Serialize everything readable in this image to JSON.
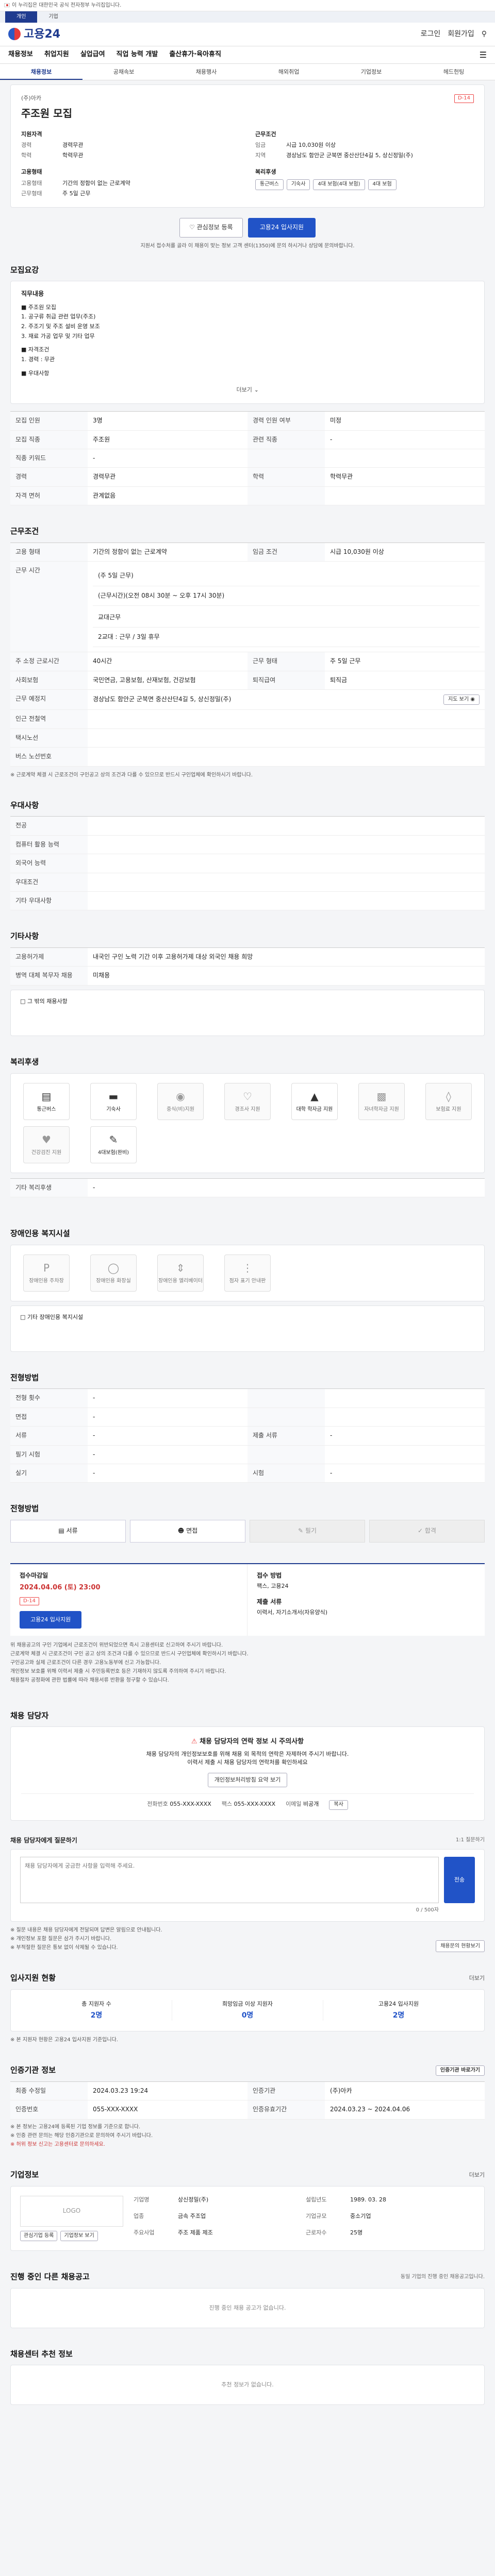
{
  "gov_bar": {
    "text": "이 누리집은 대한민국 공식 전자정부 누리집입니다."
  },
  "top_tabs": [
    {
      "label": "개인"
    },
    {
      "label": "기업"
    }
  ],
  "header": {
    "logo": "고용24",
    "right": [
      "로그인",
      "회원가입",
      "전체검색"
    ]
  },
  "gnb": [
    "채용정보",
    "취업지원",
    "실업급여",
    "직업 능력 개발",
    "출산휴가·육아휴직"
  ],
  "subnav": [
    {
      "label": "채용정보"
    },
    {
      "label": "공채속보"
    },
    {
      "label": "채용행사"
    },
    {
      "label": "해외취업"
    },
    {
      "label": "기업정보"
    },
    {
      "label": "헤드헌팅"
    }
  ],
  "job": {
    "company": "(주)아카",
    "title": "주조원 모집",
    "badge": "D-14",
    "left_h": "지원자격",
    "left": [
      [
        "경력",
        "경력무관"
      ],
      [
        "학력",
        "학력무관"
      ]
    ],
    "left_h2": "고용형태",
    "left2": [
      [
        "고용형태",
        "기간의 정함이 없는 근로계약"
      ],
      [
        "근무형태",
        "주 5일 근무"
      ]
    ],
    "right_h": "근무조건",
    "right": [
      [
        "임금",
        "시급 10,030원 이상"
      ],
      [
        "지역",
        "경상남도 함안군 군북면 중산산단4길 5, 상신정밀(주)"
      ]
    ],
    "right_h2": "복리후생",
    "chips": [
      "통근버스",
      "기숙사",
      "4대 보험(4대 보험)",
      "4대 보험"
    ],
    "btn_like": "관심정보 등록",
    "btn_apply": "고용24 입사지원",
    "notice": "지원서 접수처를 골라 이 채용이 맞는 정보 고객 센터(1350)에 문의 하시거나 상담에 문의바랍니다."
  },
  "recruit": {
    "title": "모집요강",
    "desc_label": "직무내용",
    "desc": [
      "■ 주조원 모집",
      "1. 공구류 취급 관련 업무(주조)",
      "2. 주조기 및 주조 설비 운영 보조",
      "3. 재료 가공 업무 및 기타 업무",
      "■ 자격조건",
      "1. 경력 : 무관",
      "■ 우대사항"
    ],
    "more": "더보기",
    "rows": [
      [
        "모집 인원",
        "3명",
        "경력 인원 여부",
        "미정"
      ],
      [
        "모집 직종",
        "주조원",
        "관련 직종",
        "-"
      ],
      [
        "직종 키워드",
        "-",
        "",
        ""
      ],
      [
        "경력",
        "경력무관",
        "학력",
        "학력무관"
      ],
      [
        "자격 면허",
        "관계없음",
        "",
        ""
      ]
    ]
  },
  "conditions": {
    "title": "근무조건",
    "rows": [
      [
        "고용 형태",
        "기간의 정함이 없는 근로계약",
        "임금 조건",
        "시급 10,030원 이상"
      ]
    ],
    "hours_k": "근무 시간",
    "hours": [
      "(주 5일 근무)",
      "(근무시간)(오전 08시 30분 ~ 오후 17시 30분)",
      "교대근무",
      "2교대 : 근무 / 3일 휴무"
    ],
    "rows2": [
      [
        "주 소정 근로시간",
        "40시간",
        "근무 형태",
        "주 5일 근무"
      ],
      [
        "사회보험",
        "국민연금, 고용보험, 산재보험, 건강보험",
        "퇴직급여",
        "퇴직금"
      ]
    ],
    "addr_k": "근무 예정지",
    "addr": "경상남도 함안군 군북면 중산산단4길 5, 상신정밀(주)",
    "map_btn": "지도 보기",
    "rows3": [
      [
        "인근 전철역",
        ""
      ],
      [
        "택시노선",
        ""
      ],
      [
        "버스 노선번호",
        ""
      ]
    ],
    "footnote": "※ 근로계약 체결 시 근로조건이 구인공고 상의 조건과 다를 수 있으므로 반드시 구인업체에 확인하시기 바랍니다."
  },
  "prefer": {
    "title": "우대사항",
    "rows": [
      [
        "전공",
        ""
      ],
      [
        "컴퓨터 활용 능력",
        ""
      ],
      [
        "외국어 능력",
        ""
      ],
      [
        "우대조건",
        ""
      ],
      [
        "기타 우대사항",
        ""
      ]
    ]
  },
  "etc": {
    "title": "기타사항",
    "rows": [
      [
        "고용허가제",
        "내국인 구인 노력 기간 이후 고용허가제 대상 외국인 채용 희망"
      ],
      [
        "병역 대체 복무자 채용",
        "미채용"
      ]
    ],
    "box": "그 밖의 채용사항"
  },
  "welfare": {
    "title": "복리후생",
    "items": [
      {
        "label": "통근버스",
        "icon": "bus-icon",
        "on": true
      },
      {
        "label": "기숙사",
        "icon": "bed-icon",
        "on": true
      },
      {
        "label": "중식(비)지원",
        "icon": "meal-icon",
        "on": false
      },
      {
        "label": "경조사 지원",
        "icon": "gift-icon",
        "on": false
      },
      {
        "label": "대학 학자금 지원",
        "icon": "graduation-icon",
        "on": true
      },
      {
        "label": "자녀학자금 지원",
        "icon": "book-icon",
        "on": false
      },
      {
        "label": "보험료 지원",
        "icon": "shield-icon",
        "on": false
      },
      {
        "label": "건강검진 지원",
        "icon": "heart-icon",
        "on": false
      },
      {
        "label": "4대보험(완비)",
        "icon": "doc-icon",
        "on": true
      }
    ],
    "other_k": "기타 복리후생",
    "other": "-"
  },
  "disability": {
    "title": "장애인용 복지시설",
    "items": [
      {
        "label": "장애인용 주차장"
      },
      {
        "label": "장애인용 화장실"
      },
      {
        "label": "장애인용 엘리베이터"
      },
      {
        "label": "점자 표기 안내판"
      }
    ],
    "box": "기타 장애인용 복지시설"
  },
  "selection": {
    "title": "전형방법",
    "rows": [
      [
        "전형 횟수",
        "-",
        "",
        ""
      ],
      [
        "면접",
        "-",
        "",
        ""
      ],
      [
        "서류",
        "-",
        "제출 서류",
        "-"
      ],
      [
        "필기 시험",
        "-",
        "",
        ""
      ],
      [
        "실기",
        "-",
        "시험",
        "-"
      ]
    ]
  },
  "steps": {
    "title": "전형방법",
    "items": [
      {
        "label": "서류",
        "on": true
      },
      {
        "label": "면접",
        "on": true
      },
      {
        "label": "필기",
        "on": false
      },
      {
        "label": "합격",
        "on": false
      }
    ]
  },
  "receipt": {
    "title": "접수마감일",
    "date": "2024.04.06 (토) 23:00",
    "dday": "D-14",
    "btn": "고용24 입사지원",
    "method_h": "접수 방법",
    "method": "팩스, 고용24",
    "prep_h": "제출 서류",
    "prep": "이력서, 자기소개서(자유양식)"
  },
  "notes": [
    "위 채용공고의 구인 기업에서 근로조건이 위반되었으면 즉시 고용센터로 신고하여 주시기 바랍니다.",
    "근로계약 체결 시 근로조건이 구인 공고 상의 조건과 다를 수 있으므로 반드시 구인업체에 확인하시기 바랍니다.",
    "구인공고와 실제 근로조건이 다른 경우 고용노동부에 신고 가능합니다.",
    "개인정보 보호를 위해 이력서 제출 시 주민등록번호 등은 기재하지 않도록 주의하여 주시기 바랍니다.",
    "채용절차 공정화에 관한 법률에 따라 채용서류 반환을 청구할 수 있습니다."
  ],
  "contact": {
    "title": "채용 담당자",
    "alert_title": "채용 담당자의 연락 정보 시 주의사항",
    "alert": "채용 담당자의 개인정보보호를 위해 채용 외 목적의 연락은 자제하여 주시기 바랍니다.",
    "alert2": "이력서 제출 시 채용 담당자의 연락처를 확인하세요",
    "btn_view": "개인정보처리방침 요약 보기",
    "tel_k": "전화번호",
    "tel": "055-XXX-XXXX",
    "fax_k": "팩스",
    "fax": "055-XXX-XXXX",
    "email_k": "이메일",
    "email": "비공개",
    "btn_copy": "복사"
  },
  "inquiry": {
    "title": "채용 담당자에게 질문하기",
    "sub": "1:1 질문하기",
    "placeholder": "채용 담당자에게 궁금한 사항을 입력해 주세요.",
    "count": "0 / 500자",
    "btn": "전송",
    "notes": [
      "※ 질문 내용은 채용 담당자에게 전달되며 답변은 알림으로 안내됩니다.",
      "※ 개인정보 포함 질문은 삼가 주시기 바랍니다.",
      "※ 부적절한 질문은 통보 없이 삭제될 수 있습니다."
    ],
    "more_btn": "채용문의 현황보기"
  },
  "applicants": {
    "title": "입사지원 현황",
    "more": "더보기",
    "cols": [
      {
        "label": "총 지원자 수",
        "value": "2명"
      },
      {
        "label": "희망임금 이상 지원자",
        "value": "0명"
      },
      {
        "label": "고용24 입사지원",
        "value": "2명"
      }
    ],
    "note": "※ 본 지원자 현황은 고용24 입사지원 기준입니다."
  },
  "cert": {
    "title": "인증기관 정보",
    "btn": "인증기관 바로가기",
    "rows": [
      [
        "최종 수정일",
        "2024.03.23 19:24",
        "인증기관",
        "(주)아카"
      ],
      [
        "인증번호",
        "055-XXX-XXXX",
        "인증유효기간",
        "2024.03.23 ~ 2024.04.06"
      ]
    ],
    "notes": [
      "※ 본 정보는 고용24에 등록된 기업 정보를 기준으로 합니다.",
      "※ 인증 관련 문의는 해당 인증기관으로 문의하여 주시기 바랍니다.",
      "※ 허위 정보 신고는 고용센터로 문의하세요."
    ]
  },
  "company": {
    "title": "기업정보",
    "more": "더보기",
    "logo": "LOGO",
    "rows": [
      [
        "기업명",
        "상신정밀(주)",
        "설립년도",
        "1989. 03. 28"
      ],
      [
        "업종",
        "금속 주조업",
        "기업규모",
        "중소기업"
      ],
      [
        "주요사업",
        "주조 제품 제조",
        "근로자수",
        "25명"
      ]
    ],
    "btns": [
      "관심기업 등록",
      "기업정보 보기"
    ]
  },
  "same_co": {
    "title": "진행 중인 다른 채용공고",
    "sub": "동일 기업의 진행 중인 채용공고입니다.",
    "empty": "진행 중인 채용 공고가 없습니다."
  },
  "recommend": {
    "title": "채용센터 추천 정보",
    "empty": "추천 정보가 없습니다."
  }
}
